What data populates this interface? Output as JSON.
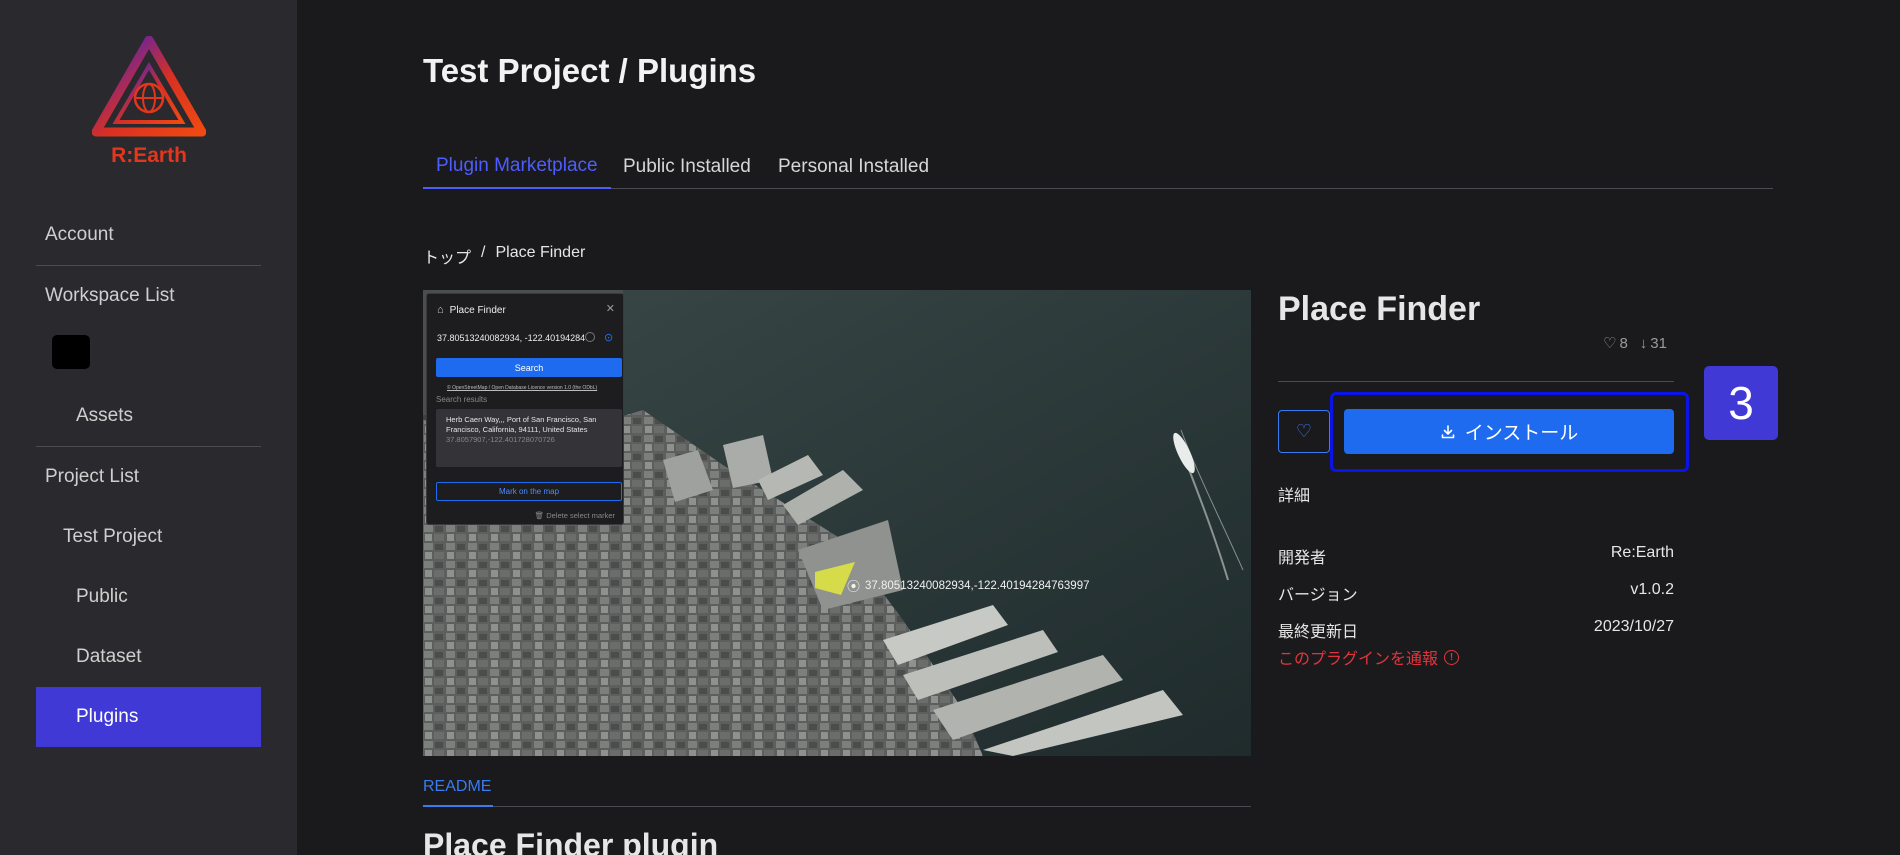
{
  "logo": {
    "text": "R:Earth"
  },
  "sidebar": {
    "account": "Account",
    "workspace_list": "Workspace List",
    "assets": "Assets",
    "project_list": "Project List",
    "project_name": "Test Project",
    "public": "Public",
    "dataset": "Dataset",
    "plugins": "Plugins"
  },
  "header": {
    "title": "Test Project / Plugins"
  },
  "tabs": [
    {
      "label": "Plugin Marketplace",
      "active": true
    },
    {
      "label": "Public Installed",
      "active": false
    },
    {
      "label": "Personal Installed",
      "active": false
    }
  ],
  "breadcrumb": {
    "root": "トップ",
    "separator": "/",
    "current": "Place Finder"
  },
  "preview": {
    "card_title": "Place Finder",
    "coords": "37.80513240082934, -122.40194284",
    "search_label": "Search",
    "license": "© OpenStreetMap / Open Database Licence version 1.0 (the ODbL)",
    "results_label": "Search results",
    "result_address": "Herb Caen Way,,, Port of San Francisco, San Francisco, California, 94111, United States",
    "result_coords": "37.8057907,-122.401728070726",
    "mark_label": "Mark on the map",
    "delete_label": "Delete select marker",
    "map_label": "37.80513240082934,-122.40194284763997"
  },
  "readme": {
    "tab": "README",
    "title": "Place Finder plugin"
  },
  "plugin": {
    "name": "Place Finder",
    "likes": "8",
    "downloads": "31",
    "install_label": "インストール",
    "step_badge": "3",
    "details_label": "詳細",
    "developer_key": "開発者",
    "developer_value": "Re:Earth",
    "version_key": "バージョン",
    "version_value": "v1.0.2",
    "updated_key": "最終更新日",
    "updated_value": "2023/10/27",
    "report_label": "このプラグインを通報"
  },
  "colors": {
    "accent": "#4039d6",
    "primary_blue": "#1e6bf0",
    "logo_red": "#e4361c",
    "danger": "#e0353d"
  }
}
